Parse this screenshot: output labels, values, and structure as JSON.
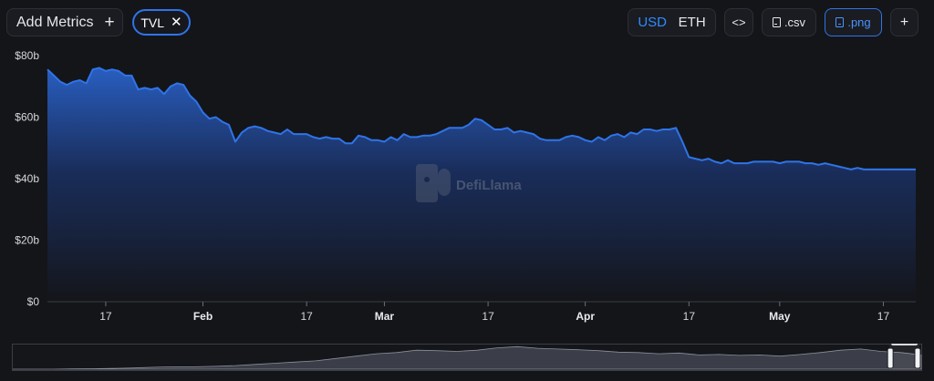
{
  "toolbar": {
    "add_metrics_label": "Add Metrics",
    "add_icon": "plus-icon",
    "chip_label": "TVL",
    "chip_close_icon": "close-icon",
    "currency_usd": "USD",
    "currency_eth": "ETH",
    "currency_selected": "USD",
    "embed_icon": "code-icon",
    "csv_label": ".csv",
    "png_label": ".png",
    "more_icon": "plus-icon",
    "accent_color": "#2f74e8"
  },
  "watermark": {
    "text": "DefiLlama",
    "icon": "llama-logo-icon"
  },
  "chart_data": {
    "type": "area",
    "title": "",
    "xlabel": "",
    "ylabel": "",
    "y_unit": "b",
    "ylim": [
      0,
      80
    ],
    "y_ticks": [
      "$0",
      "$20b",
      "$40b",
      "$60b",
      "$80b"
    ],
    "y_tick_values": [
      0,
      20,
      40,
      60,
      80
    ],
    "x_ticks": [
      {
        "label": "17",
        "date": "2022-01-17",
        "bold": false
      },
      {
        "label": "Feb",
        "date": "2022-02-01",
        "bold": true
      },
      {
        "label": "17",
        "date": "2022-02-17",
        "bold": false
      },
      {
        "label": "Mar",
        "date": "2022-03-01",
        "bold": true
      },
      {
        "label": "17",
        "date": "2022-03-17",
        "bold": false
      },
      {
        "label": "Apr",
        "date": "2022-04-01",
        "bold": true
      },
      {
        "label": "17",
        "date": "2022-04-17",
        "bold": false
      },
      {
        "label": "May",
        "date": "2022-05-01",
        "bold": true
      },
      {
        "label": "17",
        "date": "2022-05-17",
        "bold": false
      }
    ],
    "xlim": [
      "2022-01-08",
      "2022-05-22"
    ],
    "series": [
      {
        "color": "#2f74e8",
        "points": [
          [
            "2022-01-08",
            75.5
          ],
          [
            "2022-01-09",
            73.5
          ],
          [
            "2022-01-10",
            71.5
          ],
          [
            "2022-01-11",
            70.5
          ],
          [
            "2022-01-12",
            71.5
          ],
          [
            "2022-01-13",
            72.0
          ],
          [
            "2022-01-14",
            71.0
          ],
          [
            "2022-01-15",
            75.5
          ],
          [
            "2022-01-16",
            76.0
          ],
          [
            "2022-01-17",
            75.0
          ],
          [
            "2022-01-18",
            75.5
          ],
          [
            "2022-01-19",
            75.0
          ],
          [
            "2022-01-20",
            73.5
          ],
          [
            "2022-01-21",
            73.5
          ],
          [
            "2022-01-22",
            69.0
          ],
          [
            "2022-01-23",
            69.5
          ],
          [
            "2022-01-24",
            69.0
          ],
          [
            "2022-01-25",
            69.5
          ],
          [
            "2022-01-26",
            67.5
          ],
          [
            "2022-01-27",
            70.0
          ],
          [
            "2022-01-28",
            71.0
          ],
          [
            "2022-01-29",
            70.5
          ],
          [
            "2022-01-30",
            67.0
          ],
          [
            "2022-01-31",
            65.0
          ],
          [
            "2022-02-01",
            61.5
          ],
          [
            "2022-02-02",
            59.5
          ],
          [
            "2022-02-03",
            60.0
          ],
          [
            "2022-02-04",
            58.5
          ],
          [
            "2022-02-05",
            57.5
          ],
          [
            "2022-02-06",
            52.0
          ],
          [
            "2022-02-07",
            55.0
          ],
          [
            "2022-02-08",
            56.5
          ],
          [
            "2022-02-09",
            57.0
          ],
          [
            "2022-02-10",
            56.5
          ],
          [
            "2022-02-11",
            55.5
          ],
          [
            "2022-02-12",
            55.0
          ],
          [
            "2022-02-13",
            54.5
          ],
          [
            "2022-02-14",
            56.0
          ],
          [
            "2022-02-15",
            54.5
          ],
          [
            "2022-02-16",
            54.5
          ],
          [
            "2022-02-17",
            54.5
          ],
          [
            "2022-02-18",
            53.5
          ],
          [
            "2022-02-19",
            53.0
          ],
          [
            "2022-02-20",
            53.5
          ],
          [
            "2022-02-21",
            53.0
          ],
          [
            "2022-02-22",
            53.0
          ],
          [
            "2022-02-23",
            51.5
          ],
          [
            "2022-02-24",
            51.5
          ],
          [
            "2022-02-25",
            54.0
          ],
          [
            "2022-02-26",
            53.5
          ],
          [
            "2022-02-27",
            52.5
          ],
          [
            "2022-02-28",
            52.5
          ],
          [
            "2022-03-01",
            52.0
          ],
          [
            "2022-03-02",
            53.5
          ],
          [
            "2022-03-03",
            52.5
          ],
          [
            "2022-03-04",
            54.5
          ],
          [
            "2022-03-05",
            53.5
          ],
          [
            "2022-03-06",
            53.5
          ],
          [
            "2022-03-07",
            54.0
          ],
          [
            "2022-03-08",
            54.0
          ],
          [
            "2022-03-09",
            54.5
          ],
          [
            "2022-03-10",
            55.5
          ],
          [
            "2022-03-11",
            56.5
          ],
          [
            "2022-03-12",
            56.5
          ],
          [
            "2022-03-13",
            56.5
          ],
          [
            "2022-03-14",
            57.5
          ],
          [
            "2022-03-15",
            59.5
          ],
          [
            "2022-03-16",
            59.0
          ],
          [
            "2022-03-17",
            57.5
          ],
          [
            "2022-03-18",
            56.0
          ],
          [
            "2022-03-19",
            56.0
          ],
          [
            "2022-03-20",
            56.5
          ],
          [
            "2022-03-21",
            55.0
          ],
          [
            "2022-03-22",
            55.5
          ],
          [
            "2022-03-23",
            55.0
          ],
          [
            "2022-03-24",
            54.5
          ],
          [
            "2022-03-25",
            53.0
          ],
          [
            "2022-03-26",
            52.5
          ],
          [
            "2022-03-27",
            52.5
          ],
          [
            "2022-03-28",
            52.5
          ],
          [
            "2022-03-29",
            53.5
          ],
          [
            "2022-03-30",
            54.0
          ],
          [
            "2022-03-31",
            53.5
          ],
          [
            "2022-04-01",
            52.5
          ],
          [
            "2022-04-02",
            52.0
          ],
          [
            "2022-04-03",
            53.5
          ],
          [
            "2022-04-04",
            52.5
          ],
          [
            "2022-04-05",
            54.0
          ],
          [
            "2022-04-06",
            54.5
          ],
          [
            "2022-04-07",
            53.5
          ],
          [
            "2022-04-08",
            55.0
          ],
          [
            "2022-04-09",
            54.5
          ],
          [
            "2022-04-10",
            56.0
          ],
          [
            "2022-04-11",
            56.0
          ],
          [
            "2022-04-12",
            55.5
          ],
          [
            "2022-04-13",
            56.0
          ],
          [
            "2022-04-14",
            56.0
          ],
          [
            "2022-04-15",
            56.5
          ],
          [
            "2022-04-16",
            52.0
          ],
          [
            "2022-04-17",
            47.0
          ],
          [
            "2022-04-18",
            46.5
          ],
          [
            "2022-04-19",
            46.0
          ],
          [
            "2022-04-20",
            46.5
          ],
          [
            "2022-04-21",
            45.5
          ],
          [
            "2022-04-22",
            45.0
          ],
          [
            "2022-04-23",
            46.0
          ],
          [
            "2022-04-24",
            45.0
          ],
          [
            "2022-04-25",
            45.0
          ],
          [
            "2022-04-26",
            45.0
          ],
          [
            "2022-04-27",
            45.5
          ],
          [
            "2022-04-28",
            45.5
          ],
          [
            "2022-04-29",
            45.5
          ],
          [
            "2022-04-30",
            45.5
          ],
          [
            "2022-05-01",
            45.0
          ],
          [
            "2022-05-02",
            45.5
          ],
          [
            "2022-05-03",
            45.5
          ],
          [
            "2022-05-04",
            45.5
          ],
          [
            "2022-05-05",
            45.0
          ],
          [
            "2022-05-06",
            45.0
          ],
          [
            "2022-05-07",
            44.5
          ],
          [
            "2022-05-08",
            45.0
          ],
          [
            "2022-05-09",
            44.5
          ],
          [
            "2022-05-10",
            44.0
          ],
          [
            "2022-05-11",
            43.5
          ],
          [
            "2022-05-12",
            43.0
          ],
          [
            "2022-05-13",
            43.5
          ],
          [
            "2022-05-14",
            43.0
          ],
          [
            "2022-05-15",
            43.0
          ],
          [
            "2022-05-16",
            43.0
          ],
          [
            "2022-05-17",
            43.0
          ],
          [
            "2022-05-18",
            43.0
          ],
          [
            "2022-05-19",
            43.0
          ],
          [
            "2022-05-20",
            43.0
          ],
          [
            "2022-05-21",
            43.0
          ],
          [
            "2022-05-22",
            43.0
          ]
        ]
      }
    ],
    "grid": false,
    "legend": "none",
    "brush": {
      "overview": [
        0.0,
        0.0,
        0.0,
        0.01,
        0.02,
        0.03,
        0.05,
        0.08,
        0.1,
        0.1,
        0.12,
        0.15,
        0.2,
        0.25,
        0.3,
        0.35,
        0.45,
        0.55,
        0.65,
        0.7,
        0.8,
        0.78,
        0.75,
        0.8,
        0.9,
        0.95,
        0.88,
        0.85,
        0.82,
        0.78,
        0.72,
        0.7,
        0.65,
        0.68,
        0.6,
        0.62,
        0.58,
        0.6,
        0.55,
        0.62,
        0.7,
        0.8,
        0.85,
        0.75,
        0.7,
        0.6
      ],
      "selected_range": [
        0.965,
        1.0
      ]
    }
  }
}
